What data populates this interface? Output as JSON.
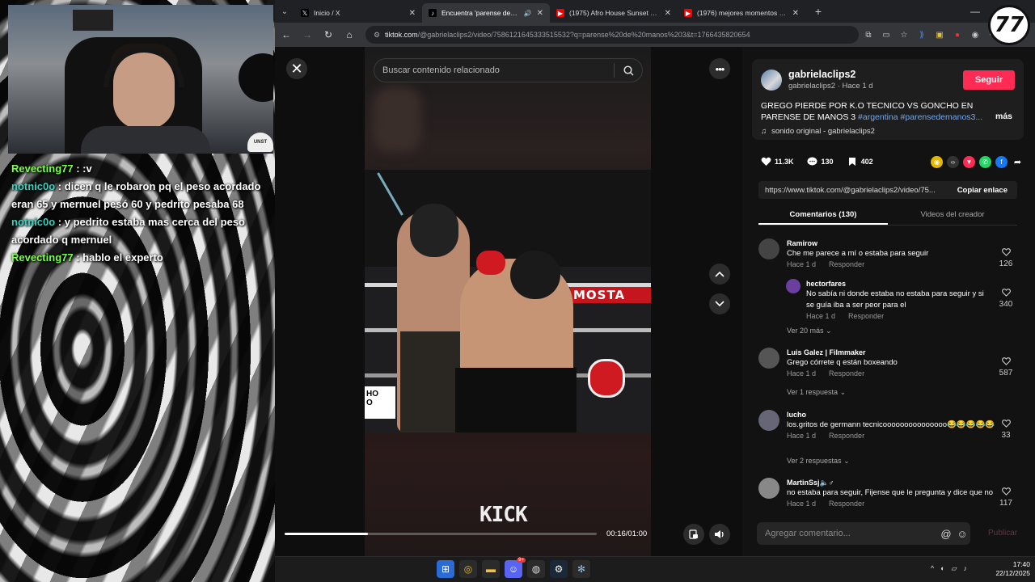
{
  "overlay": {
    "cap_text": "UNST",
    "chat": [
      {
        "user": "Revecting77",
        "color": "#7cff4a",
        "text": " : :v"
      },
      {
        "user": "notnic0o",
        "color": "#3bd1c0",
        "text": " : dicen q le robaron pq el peso acordado eran 65 y mernuel pesó 60 y pedrito pesaba 68"
      },
      {
        "user": "notnic0o",
        "color": "#3bd1c0",
        "text": " : y pedrito estaba mas cerca del peso acordado q mernuel"
      },
      {
        "user": "Revecting77",
        "color": "#7cff4a",
        "text": " : hablo el experto"
      }
    ]
  },
  "browser": {
    "tabs": [
      {
        "title": "Inicio / X",
        "icon": "x-logo-icon",
        "active": false
      },
      {
        "title": "Encuentra 'parense de man",
        "icon": "tiktok-icon",
        "active": true,
        "audio": true
      },
      {
        "title": "(1975) Afro House Sunset Mix |",
        "icon": "youtube-icon",
        "active": false
      },
      {
        "title": "(1976) mejores momentos pare",
        "icon": "youtube-icon",
        "active": false
      }
    ],
    "url_host": "tiktok.com",
    "url_path": "/@gabrielaclips2/video/7586121645333515532?q=parense%20de%20manos%203&t=1766435820654"
  },
  "video": {
    "search_placeholder": "Buscar contenido relacionado",
    "time": "00:16/01:00",
    "progress_fraction": 0.2667,
    "overlay_text": "KICK",
    "banner": "MOSTA",
    "sign_text": "HO\nO"
  },
  "post": {
    "username": "gabrielaclips2",
    "handle_time": "gabrielaclips2 · Hace 1 d",
    "follow_label": "Seguir",
    "description": "GREGO PIERDE POR K.O TECNICO VS GONCHO EN PARENSE DE MANOS 3 ",
    "tags": "#argentina #parensedemanos3...",
    "more_label": "más",
    "sound": "sonido original - gabrielaclips2",
    "likes": "11.3K",
    "comments_count": "130",
    "saves": "402",
    "link": "https://www.tiktok.com/@gabrielaclips2/video/75...",
    "copy_label": "Copiar enlace",
    "tab_comments": "Comentarios (130)",
    "tab_creator": "Videos del creador"
  },
  "comments": [
    {
      "user": "Ramirow",
      "text": "Che me parece a mí o estaba para seguir",
      "time": "Hace 1 d",
      "reply": "Responder",
      "likes": "126",
      "avatar": "#444"
    },
    {
      "user": "hectorfares",
      "text": "No sabía ni donde estaba no estaba para seguir y si se guía iba a ser peor para el",
      "time": "Hace 1 d",
      "reply": "Responder",
      "likes": "340",
      "avatar": "#6b3fa0"
    },
    {
      "user": "Luis Galez | Filmmaker",
      "text": "Grego córrete q están boxeando",
      "time": "Hace 1 d",
      "reply": "Responder",
      "likes": "587",
      "avatar": "#555"
    },
    {
      "user": "lucho",
      "text": "los.gritos de germann tecnicooooooooooooooo😂😂😂😂😂",
      "time": "Hace 1 d",
      "reply": "Responder",
      "likes": "33",
      "avatar": "#667"
    },
    {
      "user": "MartinSsj🔈♂",
      "text": "no estaba para seguir, Fijense que le pregunta y dice que no",
      "time": "Hace 1 d",
      "reply": "Responder",
      "likes": "117",
      "avatar": "#888"
    }
  ],
  "replies_links": [
    "Ver 20 más",
    "Ver 1 respuesta",
    "Ver 2 respuestas"
  ],
  "composer": {
    "placeholder": "Agregar comentario...",
    "publish_label": "Publicar"
  },
  "taskbar": {
    "time": "17:40",
    "date": "22/12/2025",
    "discord_badge": "9+"
  },
  "logo_text": "77",
  "colors": {
    "accent": "#fe2c55",
    "hashtag": "#6fa8f7"
  }
}
